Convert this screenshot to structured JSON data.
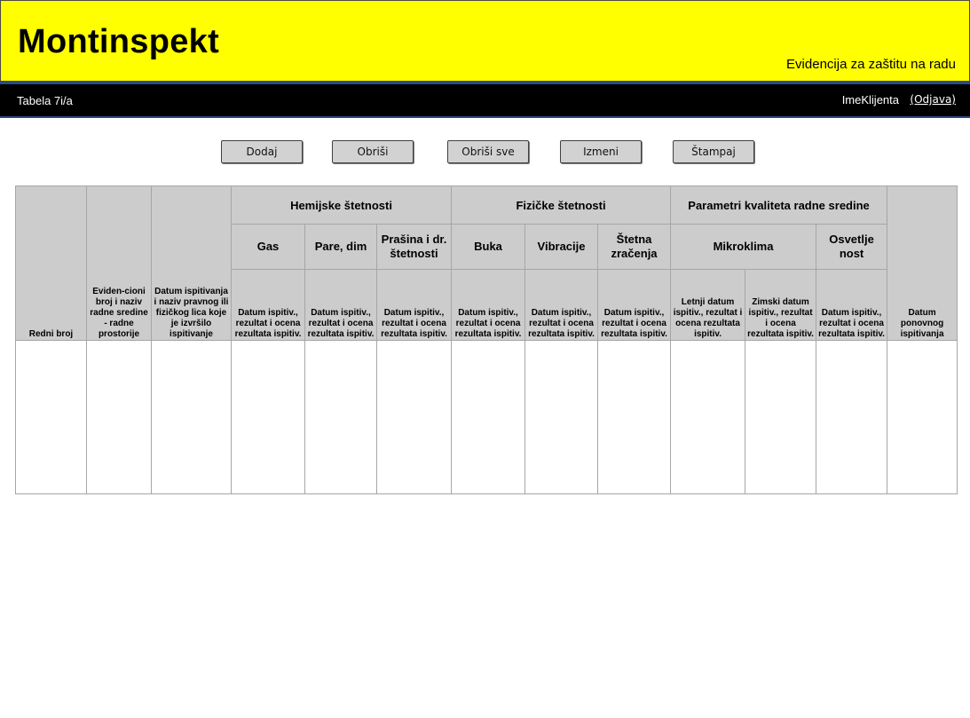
{
  "header": {
    "title": "Montinspekt",
    "subtitle": "Evidencija za zaštitu na radu"
  },
  "nav": {
    "table_label": "Tabela 7i/a",
    "user": "ImeKlijenta",
    "logout": "(Odjava)"
  },
  "toolbar": {
    "add": "Dodaj",
    "delete": "Obriši",
    "delete_all": "Obriši sve",
    "edit": "Izmeni",
    "print": "Štampaj"
  },
  "table": {
    "col_redni_broj": "Redni broj",
    "col_evidencioni": "Eviden-cioni broj i naziv radne sredine - radne prostorije",
    "col_datum_ispitivanja": "Datum ispitivanja i naziv pravnog ili fizičkog lica koje je izvršilo ispitivanje",
    "group_hemijske": "Hemijske štetnosti",
    "group_fizicke": "Fizičke štetnosti",
    "group_parametri": "Parametri kvaliteta radne sredine",
    "sub_gas": "Gas",
    "sub_pare": "Pare, dim",
    "sub_prasina": "Prašina i dr. štetnosti",
    "sub_buka": "Buka",
    "sub_vibracije": "Vibracije",
    "sub_stetna": "Štetna zračenja",
    "sub_mikroklima": "Mikroklima",
    "sub_osvetljenost": "Osvetlje nost",
    "detail_generic": "Datum ispitiv., rezultat i ocena rezultata ispitiv.",
    "detail_letnji": "Letnji datum ispitiv., rezultat i ocena rezultata ispitiv.",
    "detail_zimski": "Zimski datum ispitiv., rezultat i ocena rezultata ispitiv.",
    "col_ponovno": "Datum ponovnog ispitivanja"
  }
}
